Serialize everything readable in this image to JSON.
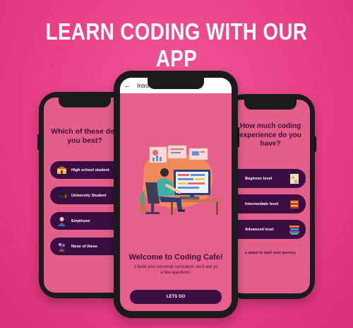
{
  "headline": "LEARN CODING WITH OUR APP",
  "left_screen": {
    "question": "Which of these des you best?",
    "question_line1": "Which of these des",
    "question_line2": "you best?",
    "options": [
      {
        "label": "High school student",
        "icon": "school-icon"
      },
      {
        "label": "University Student",
        "icon": "graduation-cap-icon"
      },
      {
        "label": "Employee",
        "icon": "employee-icon"
      },
      {
        "label": "None of these",
        "icon": "flower-icon"
      }
    ]
  },
  "center_screen": {
    "app_bar_title": "IntroScreen",
    "back_icon": "back-arrow-icon",
    "welcome_title": "Welcome to Coding Cafe!",
    "subtitle_line1": "o build your personal curriculum, we'll ask yo",
    "subtitle_line2": "a few questions.",
    "button_label": "LETS GO"
  },
  "right_screen": {
    "question_line1": "How much coding",
    "question_line2": "experience do you",
    "question_line3": "have?",
    "levels": [
      {
        "label": "Beginner level",
        "icon": "blocks-icon"
      },
      {
        "label": "Intermediate level",
        "icon": "books-icon"
      },
      {
        "label": "Advanced level",
        "icon": "book-stack-icon"
      }
    ],
    "footer": "e about to start your journey"
  },
  "colors": {
    "background": "#e83f86",
    "screen": "#e35f8a",
    "accent_dark": "#3c0d43",
    "title_text": "#3e0d3e"
  }
}
